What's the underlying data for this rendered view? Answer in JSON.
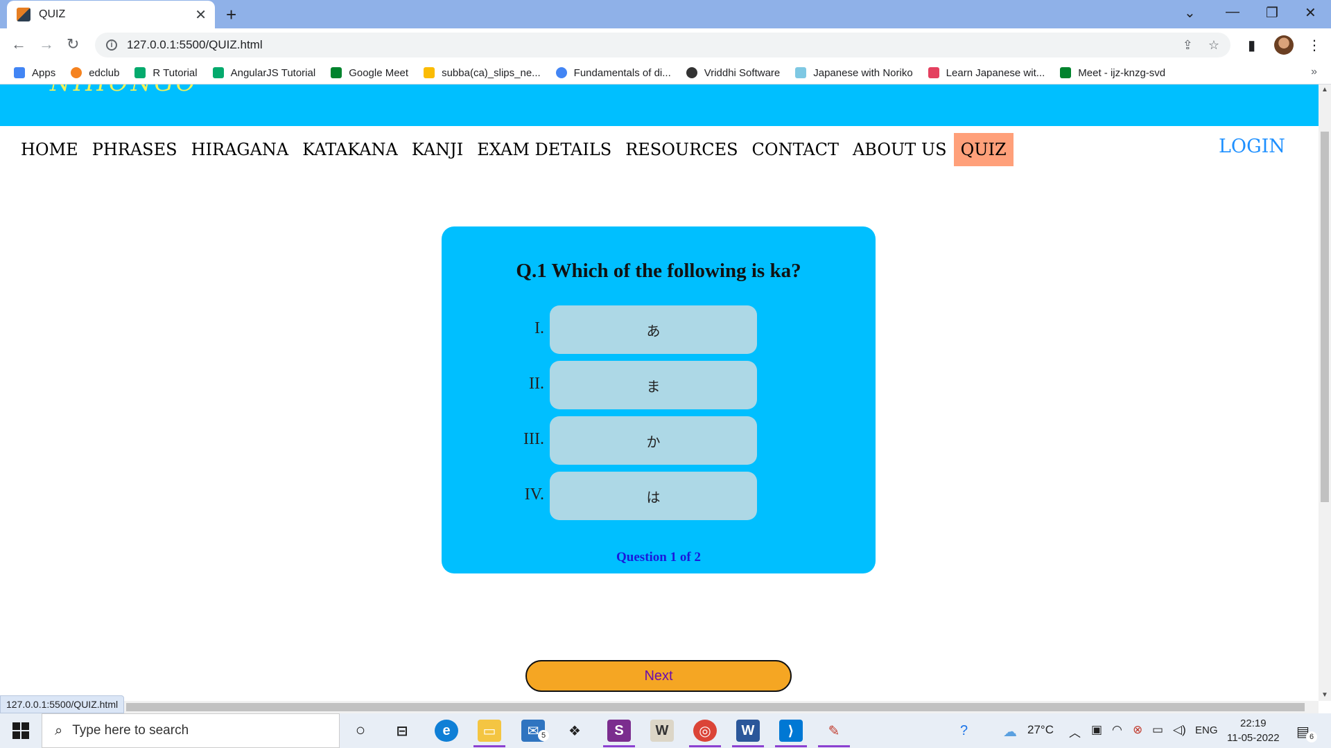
{
  "browser": {
    "tab_title": "QUIZ",
    "url": "127.0.0.1:5500/QUIZ.html",
    "status_url": "127.0.0.1:5500/QUIZ.html",
    "bookmarks": [
      {
        "label": "Apps",
        "icon": "apps-grid-icon",
        "color": "#4285f4"
      },
      {
        "label": "edclub",
        "icon": "edclub-icon",
        "color": "#f5821f"
      },
      {
        "label": "R Tutorial",
        "icon": "w3schools-icon",
        "color": "#04aa6d"
      },
      {
        "label": "AngularJS Tutorial",
        "icon": "w3schools-icon",
        "color": "#04aa6d"
      },
      {
        "label": "Google Meet",
        "icon": "google-meet-icon",
        "color": "#00832d"
      },
      {
        "label": "subba(ca)_slips_ne...",
        "icon": "google-drive-icon",
        "color": "#fbbc04"
      },
      {
        "label": "Fundamentals of di...",
        "icon": "google-icon",
        "color": "#4285f4"
      },
      {
        "label": "Vriddhi Software",
        "icon": "globe-icon",
        "color": "#333333"
      },
      {
        "label": "Japanese with Noriko",
        "icon": "site-icon",
        "color": "#7ec8e3"
      },
      {
        "label": "Learn Japanese wit...",
        "icon": "podcast-icon",
        "color": "#e4405f"
      },
      {
        "label": "Meet - ijz-knzg-svd",
        "icon": "google-meet-icon",
        "color": "#00832d"
      }
    ]
  },
  "site": {
    "logo_text": "NIHONGO",
    "nav": [
      "HOME",
      "PHRASES",
      "HIRAGANA",
      "KATAKANA",
      "KANJI",
      "EXAM DETAILS",
      "RESOURCES",
      "CONTACT",
      "ABOUT US",
      "QUIZ"
    ],
    "active_nav": "QUIZ",
    "login": "LOGIN"
  },
  "quiz": {
    "question": "Q.1 Which of the following is ka?",
    "options": [
      {
        "num": "I.",
        "text": "あ"
      },
      {
        "num": "II.",
        "text": "ま"
      },
      {
        "num": "III.",
        "text": "か"
      },
      {
        "num": "IV.",
        "text": "は"
      }
    ],
    "progress": "Question 1 of 2",
    "next_label": "Next"
  },
  "taskbar": {
    "search_placeholder": "Type here to search",
    "weather": "27°C",
    "language": "ENG",
    "time": "22:19",
    "date": "11-05-2022",
    "mail_badge": "5",
    "notification_badge": "6"
  },
  "colors": {
    "banner": "#00bfff",
    "card": "#00bfff",
    "option": "#add8e6",
    "active_nav": "#ffa07a",
    "next_button": "#f5a623",
    "login": "#1e90ff"
  }
}
